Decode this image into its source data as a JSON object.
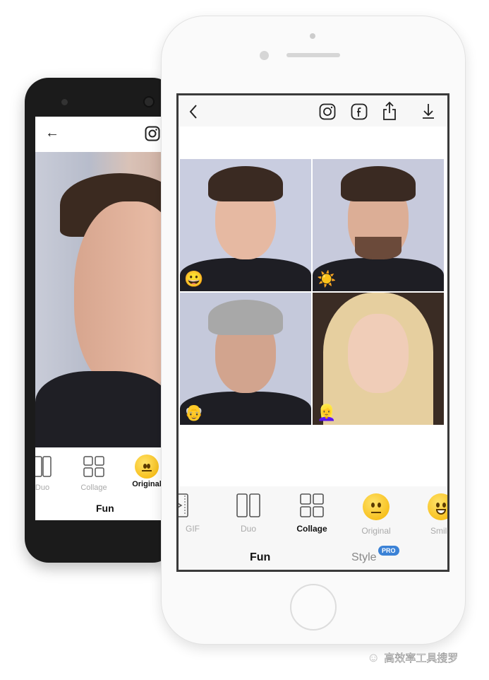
{
  "back_phone": {
    "photo_filter": "Original",
    "tools": [
      {
        "label": "Duo",
        "icon": "duo-icon"
      },
      {
        "label": "Collage",
        "icon": "collage-icon"
      },
      {
        "label": "Original",
        "icon": "neutral-face-emoji",
        "selected": true
      }
    ],
    "tabs": [
      "Fun"
    ]
  },
  "front_phone": {
    "header_icons": [
      "back-icon",
      "instagram-icon",
      "facebook-icon",
      "share-icon",
      "download-icon"
    ],
    "collage_badges": [
      "😀",
      "☀️",
      "👴",
      "👱‍♀️"
    ],
    "tools": [
      {
        "label": "GIF",
        "icon": "gif-icon"
      },
      {
        "label": "Duo",
        "icon": "duo-icon"
      },
      {
        "label": "Collage",
        "icon": "collage-icon",
        "selected": true
      },
      {
        "label": "Original",
        "icon": "neutral-face-emoji"
      },
      {
        "label": "Smile",
        "icon": "smile-face-emoji"
      }
    ],
    "tabs": [
      {
        "label": "Fun",
        "selected": true
      },
      {
        "label": "Style",
        "badge": "PRO"
      }
    ],
    "pro_badge_color": "#3b82d6"
  },
  "watermark": "高效率工具搜罗"
}
